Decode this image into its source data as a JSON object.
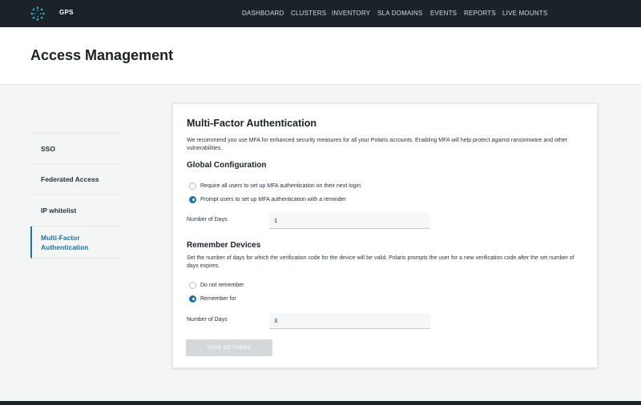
{
  "app": {
    "name": "GPS",
    "logo_icon": "polaris-logo-icon",
    "accent": "#1a74a8",
    "topbar_color": "#1c2328"
  },
  "nav": {
    "items": [
      {
        "label": "DASHBOARD"
      },
      {
        "label": "CLUSTERS"
      },
      {
        "label": "INVENTORY"
      },
      {
        "label": "SLA DOMAINS"
      },
      {
        "label": "EVENTS"
      },
      {
        "label": "REPORTS"
      },
      {
        "label": "LIVE MOUNTS"
      }
    ]
  },
  "page": {
    "title": "Access Management"
  },
  "sidebar": {
    "items": [
      {
        "label": "SSO",
        "active": false
      },
      {
        "label": "Federated Access",
        "active": false
      },
      {
        "label": "IP whitelist",
        "active": false
      },
      {
        "label": "Multi-Factor Authentication",
        "active": true
      }
    ]
  },
  "mfa": {
    "title": "Multi-Factor Authentication",
    "description": "We recommend you use MFA for enhanced security measures for all your Polaris accounts. Enabling MFA will help protect against ransomware and other vulnerabilities.",
    "global": {
      "title": "Global Configuration",
      "options": [
        {
          "label": "Require all users to set up MFA authentication on their next login",
          "checked": false
        },
        {
          "label": "Prompt users to set up MFA authentication with a reminder",
          "checked": true
        }
      ],
      "days_label": "Number of Days",
      "days_value": "1"
    },
    "remember": {
      "title": "Remember Devices",
      "description": "Set the number of days for which the verification code for the device will be valid. Polaris prompts the user for a new verification code after the set number of days expires.",
      "options": [
        {
          "label": "Do not remember",
          "checked": false
        },
        {
          "label": "Remember for",
          "checked": true
        }
      ],
      "days_label": "Number of Days",
      "days_value": "3"
    },
    "save_label": "SAVE SETTINGS"
  }
}
